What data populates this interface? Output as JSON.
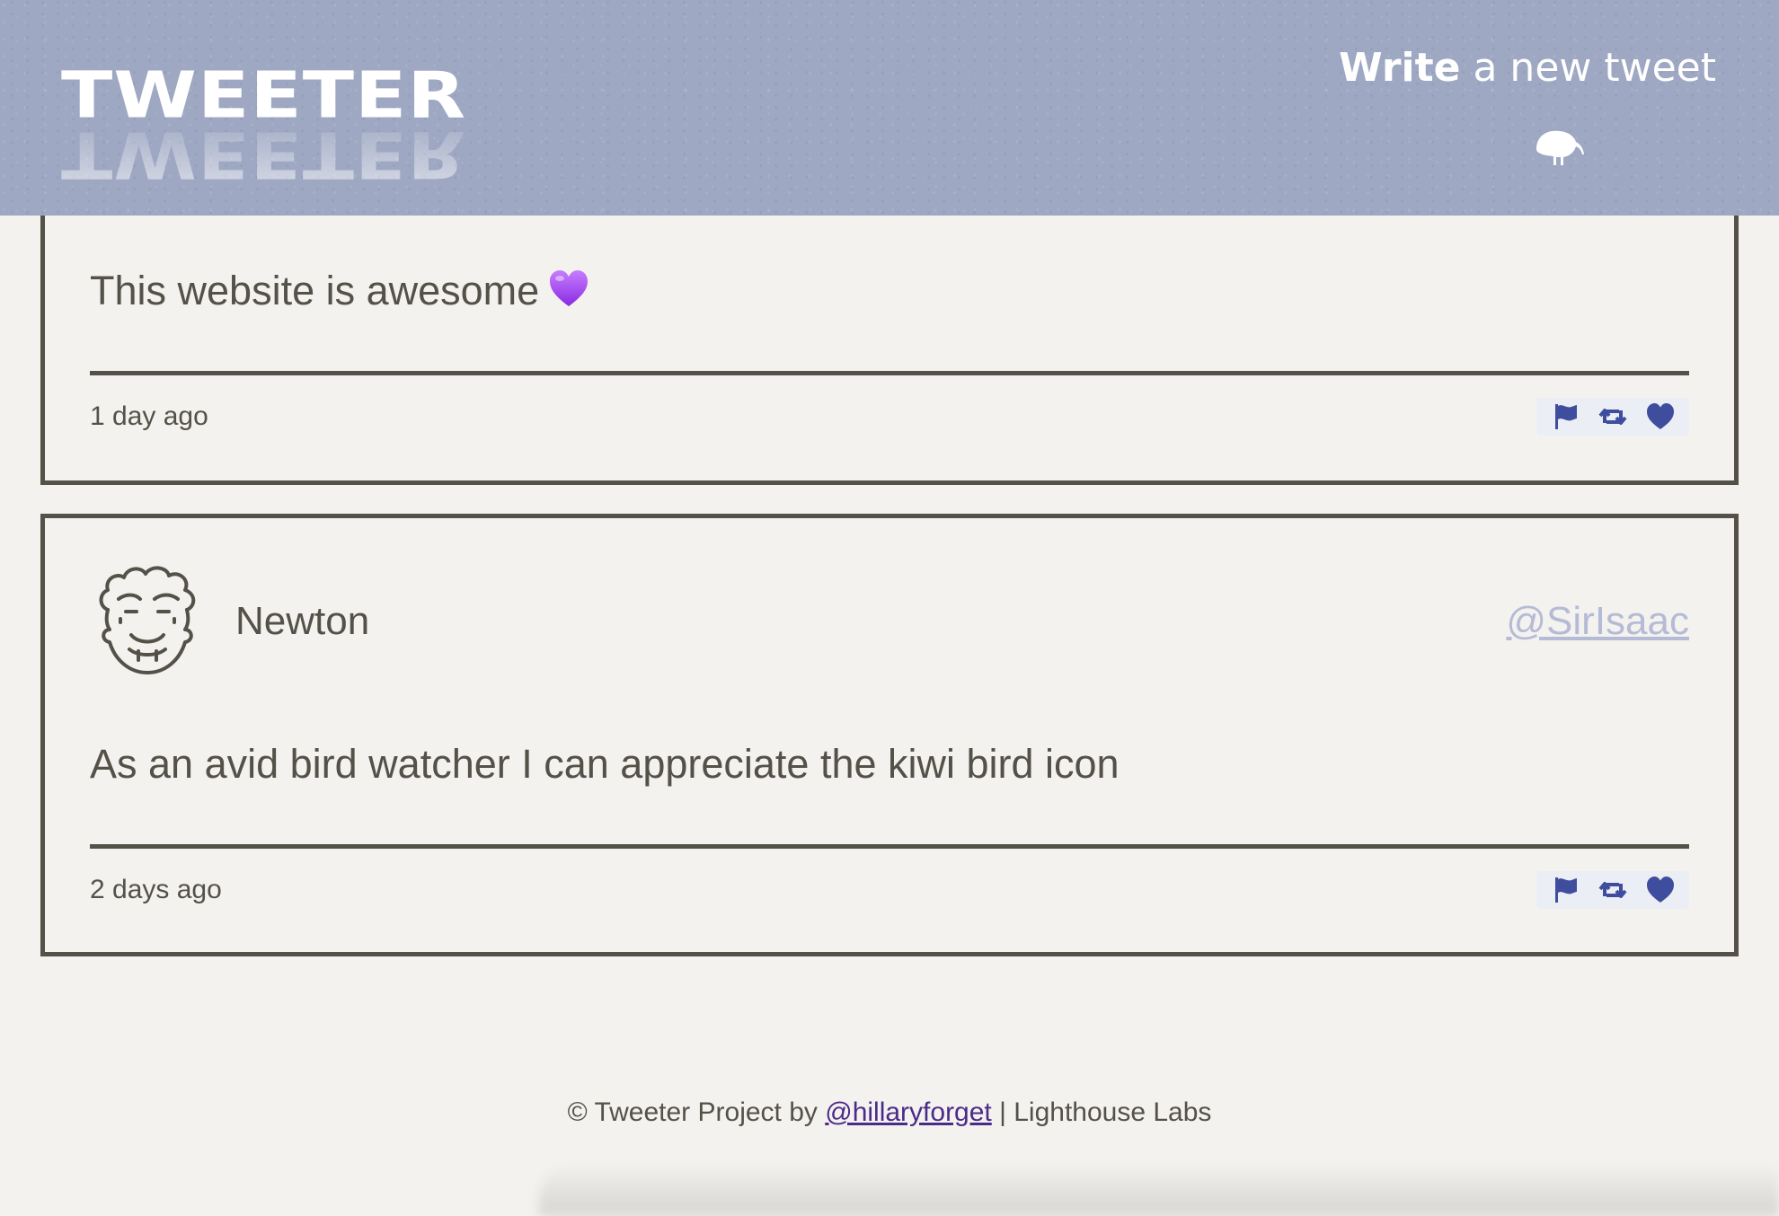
{
  "nav": {
    "logo_text": "TWEETER",
    "compose_bold": "Write",
    "compose_rest": " a new tweet",
    "compose_icon": "kiwi-bird-icon"
  },
  "colors": {
    "nav_bg": "#9ea8c3",
    "page_bg": "#f4f2ee",
    "text": "#545149",
    "action_icon": "#3f4d9e",
    "handle": "#b5bbd6",
    "link": "#4b2b8a"
  },
  "tweets": [
    {
      "content": "This website is awesome",
      "emoji": "purple-heart-emoji",
      "time": "1 day ago",
      "actions": [
        "flag-icon",
        "retweet-icon",
        "heart-icon"
      ]
    },
    {
      "name": "Newton",
      "handle": "@SirIsaac",
      "avatar": "newton-avatar",
      "content": "As an avid bird watcher I can appreciate the kiwi bird icon",
      "time": "2 days ago",
      "actions": [
        "flag-icon",
        "retweet-icon",
        "heart-icon"
      ]
    }
  ],
  "footer": {
    "prefix": "© Tweeter Project by ",
    "link": "@hillaryforget",
    "suffix": " | Lighthouse Labs"
  }
}
